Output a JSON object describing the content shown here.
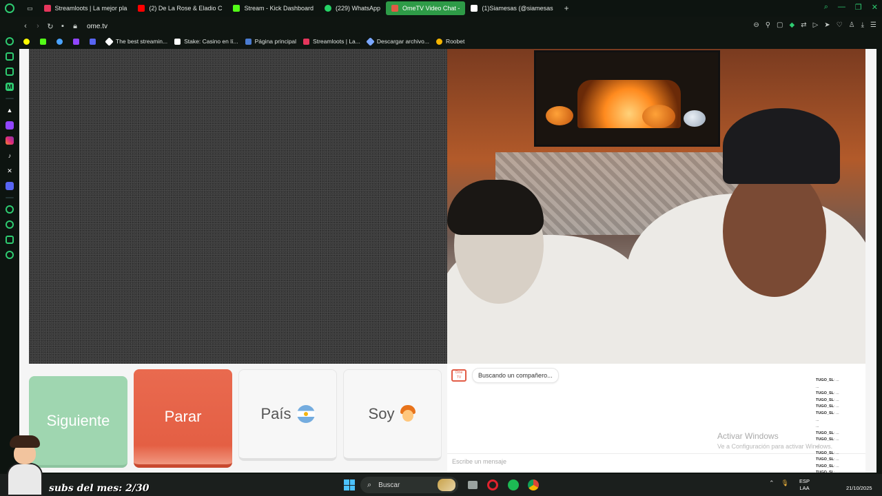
{
  "tabs": [
    {
      "label": "Streamloots | La mejor pla",
      "icon": "streamloots-icon",
      "color": "#e5365c"
    },
    {
      "label": "(2) De La Rose & Eladio C",
      "icon": "youtube-icon",
      "color": "#ff0000"
    },
    {
      "label": "Stream - Kick Dashboard",
      "icon": "kick-icon",
      "color": "#53fc18"
    },
    {
      "label": "(229) WhatsApp",
      "icon": "whatsapp-icon",
      "color": "#25d366"
    },
    {
      "label": "OmeTV Video Chat -",
      "icon": "ometv-icon",
      "color": "#e25b45",
      "active": true
    },
    {
      "label": "(1)Siamesas (@siamesas",
      "icon": "tiktok-icon",
      "color": "#ffffff"
    }
  ],
  "addressbar": {
    "url": "ome.tv"
  },
  "bookmarks": [
    {
      "label": "",
      "icon": "snapchat-icon",
      "color": "#fffc00"
    },
    {
      "label": "",
      "icon": "kick-icon",
      "color": "#53fc18"
    },
    {
      "label": "",
      "icon": "globe-icon",
      "color": "#4aa3ff"
    },
    {
      "label": "",
      "icon": "twitch-icon",
      "color": "#9146ff"
    },
    {
      "label": "",
      "icon": "discord-icon",
      "color": "#5865f2"
    },
    {
      "label": "The best streamin...",
      "icon": "streaming-icon",
      "color": "#ffffff"
    },
    {
      "label": "Stake: Casino en lí...",
      "icon": "stake-icon",
      "color": "#ffffff"
    },
    {
      "label": "Página principal",
      "icon": "home-icon",
      "color": "#4a7bd1"
    },
    {
      "label": "Streamloots | La...",
      "icon": "streamloots-icon",
      "color": "#e5365c"
    },
    {
      "label": "Descargar archivo...",
      "icon": "download-icon",
      "color": "#7aa7ff"
    },
    {
      "label": "Roobet",
      "icon": "roobet-icon",
      "color": "#f4b400"
    }
  ],
  "buttons": {
    "next": "Siguiente",
    "stop": "Parar",
    "country": "País",
    "me": "Soy"
  },
  "chat": {
    "logo_text": "Ome TV",
    "status_message": "Buscando un compañero...",
    "input_placeholder": "Escribe un mensaje"
  },
  "windows_watermark": {
    "title": "Activar Windows",
    "subtitle": "Ve a Configuración para activar Windows."
  },
  "overlay_chat": [
    {
      "user": "TUGO_SL",
      "text": ": ..."
    },
    {
      "user": "",
      "text": "..."
    },
    {
      "user": "TUGO_SL",
      "text": ": ..."
    },
    {
      "user": "TUGO_SL",
      "text": ": ..."
    },
    {
      "user": "TUGO_SL",
      "text": ": ..."
    },
    {
      "user": "TUGO_SL",
      "text": ": ..."
    },
    {
      "user": "",
      "text": "..."
    },
    {
      "user": "",
      "text": "..."
    },
    {
      "user": "TUGO_SL",
      "text": ": ..."
    },
    {
      "user": "TUGO_SL",
      "text": ": ..."
    },
    {
      "user": "",
      "text": "..."
    },
    {
      "user": "TUGO_SL",
      "text": ": ..."
    },
    {
      "user": "TUGO_SL",
      "text": ": ..."
    },
    {
      "user": "TUGO_SL",
      "text": ": ..."
    },
    {
      "user": "TUGO_SL",
      "text": ": ..."
    }
  ],
  "stream_overlay": {
    "subs_label": "subs del mes: 2/30"
  },
  "taskbar": {
    "search_label": "Buscar",
    "language": "ESP",
    "language_sub": "LAA",
    "date": "21/10/2025"
  }
}
